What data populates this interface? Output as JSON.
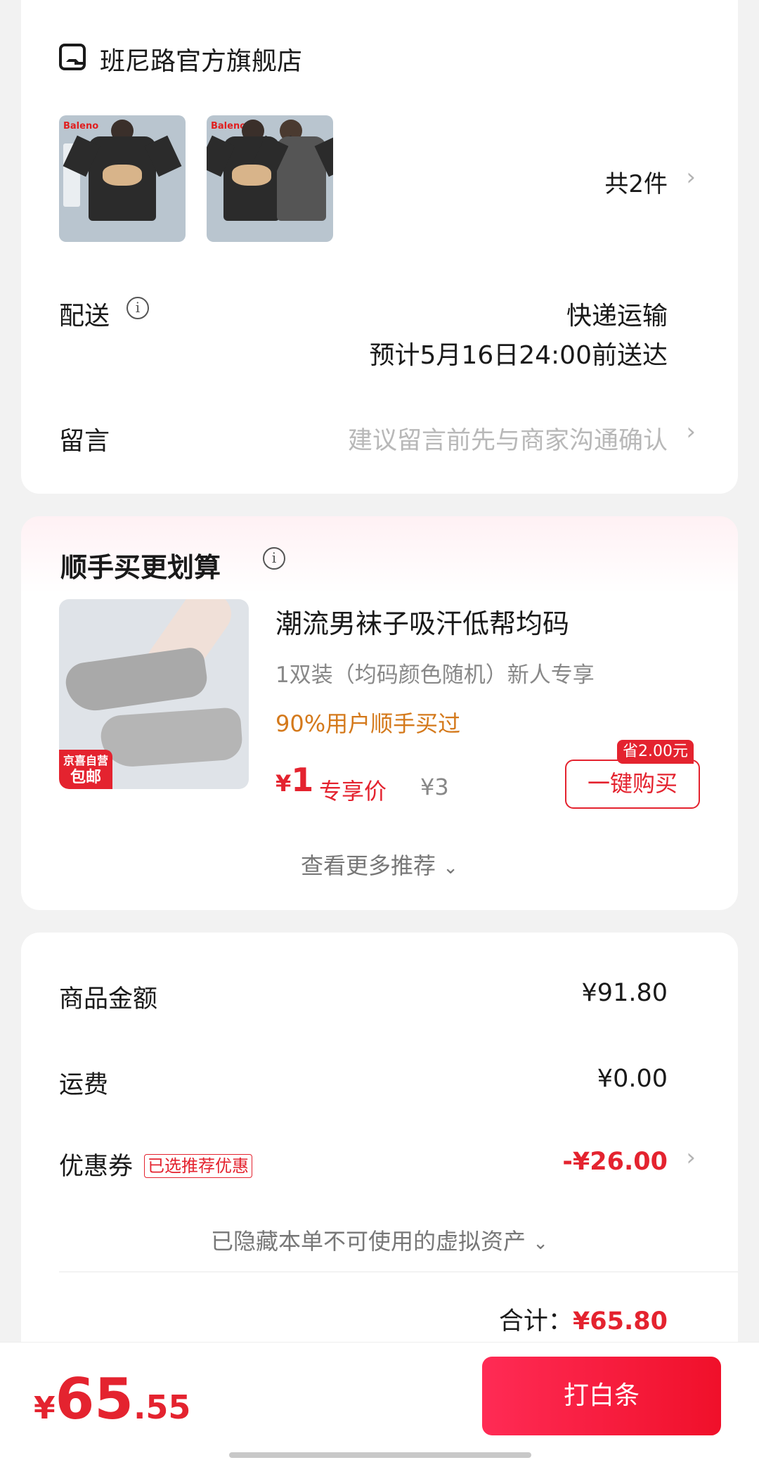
{
  "shop": {
    "name": "班尼路官方旗舰店",
    "product_brand": "Baleno",
    "item_count": "共2件",
    "delivery_label": "配送",
    "delivery_method": "快递运输",
    "delivery_eta": "预计5月16日24:00前送达",
    "message_label": "留言",
    "message_placeholder": "建议留言前先与商家沟通确认"
  },
  "recommend": {
    "title": "顺手买更划算",
    "product_title": "潮流男袜子吸汗低帮均码",
    "product_spec": "1双装（均码颜色随机）新人专享",
    "social_proof": "90%用户顺手买过",
    "badge_line1": "京喜自营",
    "badge_line2": "包邮",
    "price_symbol": "¥",
    "price": "1",
    "price_label": "专享价",
    "original_price": "¥3",
    "save_tag": "省2.00元",
    "buy_button": "一键购买",
    "more": "查看更多推荐"
  },
  "summary": {
    "goods_label": "商品金额",
    "goods_value": "¥91.80",
    "shipping_label": "运费",
    "shipping_value": "¥0.00",
    "coupon_label": "优惠券",
    "coupon_tag": "已选推荐优惠",
    "coupon_value": "-¥26.00",
    "hidden_assets": "已隐藏本单不可使用的虚拟资产",
    "total_label": "合计：",
    "total_value": "¥65.80"
  },
  "bottom": {
    "currency": "¥",
    "amount_int": "65",
    "amount_dec": ".55",
    "pay_button": "打白条"
  },
  "colors": {
    "accent_red": "#e4232f",
    "orange": "#d4791b"
  }
}
